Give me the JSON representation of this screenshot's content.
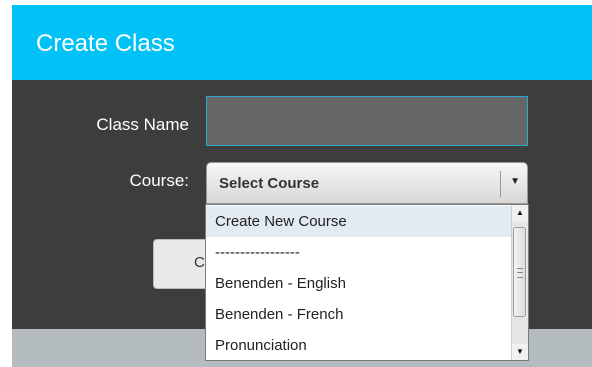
{
  "dialog": {
    "title": "Create Class",
    "class_name_label": "Class Name",
    "course_label": "Course:",
    "class_name_value": "",
    "course_select_value": "Select Course",
    "partial_button_text": "C"
  },
  "course_dropdown": {
    "options": [
      "Create New Course",
      "-----------------",
      "Benenden - English",
      "Benenden - French",
      "Pronunciation"
    ],
    "highlighted_index": 0
  },
  "icons": {
    "select_arrow": "chevron-down-icon",
    "scroll_up": "arrow-up-icon",
    "scroll_down": "arrow-down-icon"
  },
  "colors": {
    "header": "#00c2f7",
    "body": "#3d3d3d",
    "footer": "#b4bcc0",
    "input_border": "#2aa8d0",
    "highlight": "#e3ebf2"
  }
}
